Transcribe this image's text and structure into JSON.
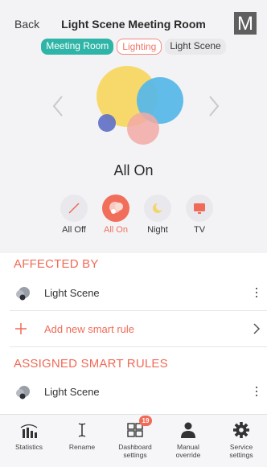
{
  "header": {
    "back_label": "Back",
    "title": "Light Scene Meeting Room",
    "logo_letter": "M"
  },
  "breadcrumbs": [
    {
      "label": "Meeting Room",
      "state": "active"
    },
    {
      "label": "Lighting",
      "state": "outlined"
    },
    {
      "label": "Light Scene",
      "state": "plain"
    }
  ],
  "scene": {
    "name": "All On",
    "circle_colors": [
      "#f7d96b",
      "#5ab8e8",
      "#f2a9a4",
      "#5d6fc7"
    ]
  },
  "modes": [
    {
      "label": "All Off",
      "icon": "off-slash-icon",
      "selected": false
    },
    {
      "label": "All On",
      "icon": "all-on-bubbles-icon",
      "selected": true
    },
    {
      "label": "Night",
      "icon": "night-moon-icon",
      "selected": false
    },
    {
      "label": "TV",
      "icon": "tv-icon",
      "selected": false
    }
  ],
  "affected_by": {
    "heading": "AFFECTED BY",
    "items": [
      {
        "label": "Light Scene",
        "icon": "scene-bubbles-icon"
      }
    ],
    "add_rule_label": "Add new smart rule"
  },
  "assigned_rules": {
    "heading": "ASSIGNED SMART RULES",
    "items": [
      {
        "label": "Light Scene",
        "icon": "scene-bubbles-icon"
      }
    ]
  },
  "toolbar": {
    "statistics": "Statistics",
    "rename": "Rename",
    "dashboard": "Dashboard settings",
    "dashboard_badge": "19",
    "manual_override": "Manual override",
    "service": "Service settings"
  },
  "colors": {
    "accent": "#f06a57",
    "teal": "#2fb5a8"
  }
}
